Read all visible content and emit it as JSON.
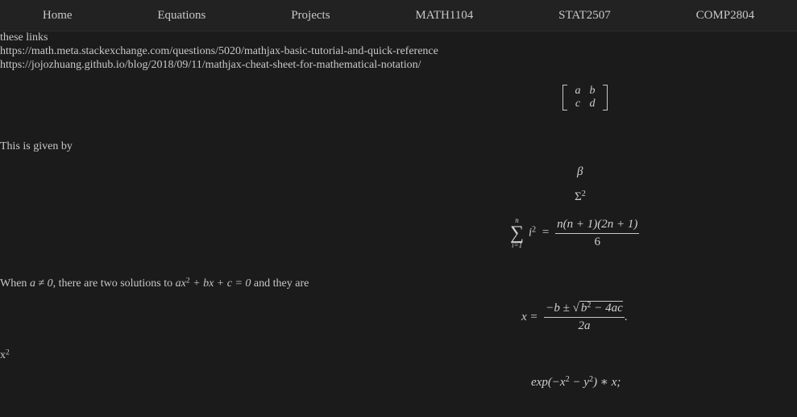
{
  "nav": [
    "Home",
    "Equations",
    "Projects",
    "MATH1104",
    "STAT2507",
    "COMP2804"
  ],
  "intro_text": "these links",
  "links": [
    "https://math.meta.stackexchange.com/questions/5020/mathjax-basic-tutorial-and-quick-reference",
    "https://jojozhuang.github.io/blog/2018/09/11/mathjax-cheat-sheet-for-mathematical-notation/"
  ],
  "matrix": {
    "a": "a",
    "b": "b",
    "c": "c",
    "d": "d"
  },
  "given_text": "This is given by",
  "beta": "β",
  "sigma": "Σ",
  "sigma_exp": "2",
  "sum_formula": {
    "upper": "n",
    "lower": "i=1",
    "term": "i",
    "term_exp": "2",
    "equals": "=",
    "numerator": "n(n + 1)(2n + 1)",
    "denominator": "6"
  },
  "quad_text": {
    "prefix": "When",
    "cond": "a ≠ 0",
    "middle": ", there are two solutions to",
    "eq_a": "ax",
    "eq_exp": "2",
    "eq_rest": " + bx + c = 0",
    "suffix": "and they are"
  },
  "quadratic": {
    "lhs": "x =",
    "num_left": "−b ±",
    "radicand_base": "b",
    "radicand_exp": "2",
    "radicand_rest": " − 4ac",
    "den": "2a",
    "end": "."
  },
  "x_squared": {
    "base": "x",
    "exp": "2"
  },
  "exp_expr": {
    "pre": "exp(−x",
    "exp1": "2",
    "mid": " − y",
    "exp2": "2",
    "post": ") ∗ x;"
  }
}
